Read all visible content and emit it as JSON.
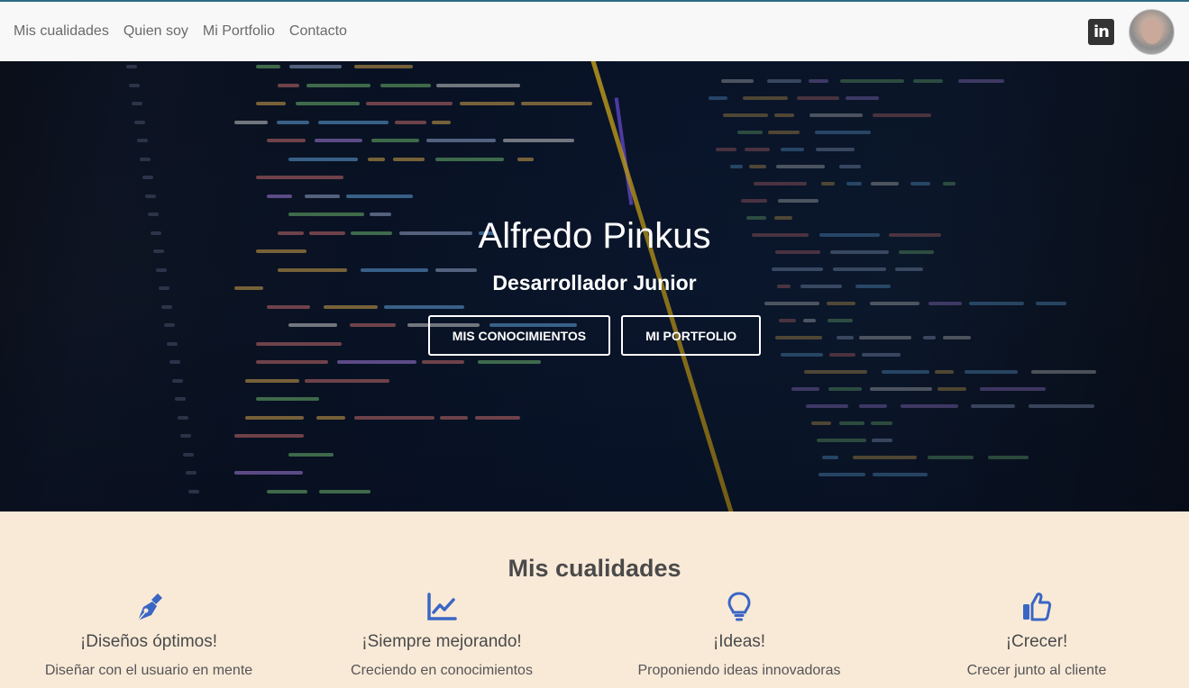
{
  "nav": {
    "links": [
      "Mis cualidades",
      "Quien soy",
      "Mi Portfolio",
      "Contacto"
    ],
    "linkedin_icon": "linkedin-icon",
    "linkedin_text": "in",
    "avatar_icon": "profile-avatar"
  },
  "hero": {
    "title": "Alfredo Pinkus",
    "subtitle": "Desarrollador Junior",
    "buttons": [
      "MIS CONOCIMIENTOS",
      "MI PORTFOLIO"
    ]
  },
  "qualities": {
    "title": "Mis cualidades",
    "items": [
      {
        "icon": "pen-nib-icon",
        "title": "¡Diseños óptimos!",
        "desc": "Diseñar con el usuario en mente"
      },
      {
        "icon": "chart-line-icon",
        "title": "¡Siempre mejorando!",
        "desc": "Creciendo en conocimientos"
      },
      {
        "icon": "lightbulb-icon",
        "title": "¡Ideas!",
        "desc": "Proponiendo ideas innovadoras"
      },
      {
        "icon": "thumbs-up-icon",
        "title": "¡Crecer!",
        "desc": "Crecer junto al cliente"
      }
    ]
  },
  "colors": {
    "accent_icon": "#3a66c4",
    "section_bg": "#f9ead8",
    "nav_bg": "#f8f8f8"
  }
}
